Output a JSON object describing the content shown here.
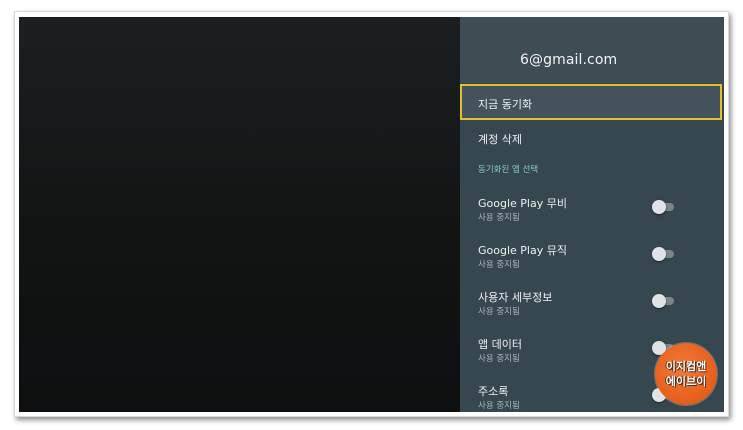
{
  "account": {
    "email": "6@gmail.com"
  },
  "menu": {
    "sync_now": "지금 동기화",
    "delete_account": "계정 삭제",
    "section_label": "동기화된 앱 선택"
  },
  "apps": [
    {
      "name": "Google Play 무비",
      "status": "사용 중지됨",
      "enabled": false
    },
    {
      "name": "Google Play 뮤직",
      "status": "사용 중지됨",
      "enabled": false
    },
    {
      "name": "사용자 세부정보",
      "status": "사용 중지됨",
      "enabled": false
    },
    {
      "name": "앱 데이터",
      "status": "사용 중지됨",
      "enabled": false
    },
    {
      "name": "주소록",
      "status": "사용 중지됨",
      "enabled": false
    }
  ],
  "watermark": {
    "line1": "이지컴앤",
    "line2": "에이브이"
  },
  "colors": {
    "panel": "#37474f",
    "focus_border": "#e3c02a",
    "section_label": "#80cbc4",
    "watermark": "#e8621e"
  }
}
